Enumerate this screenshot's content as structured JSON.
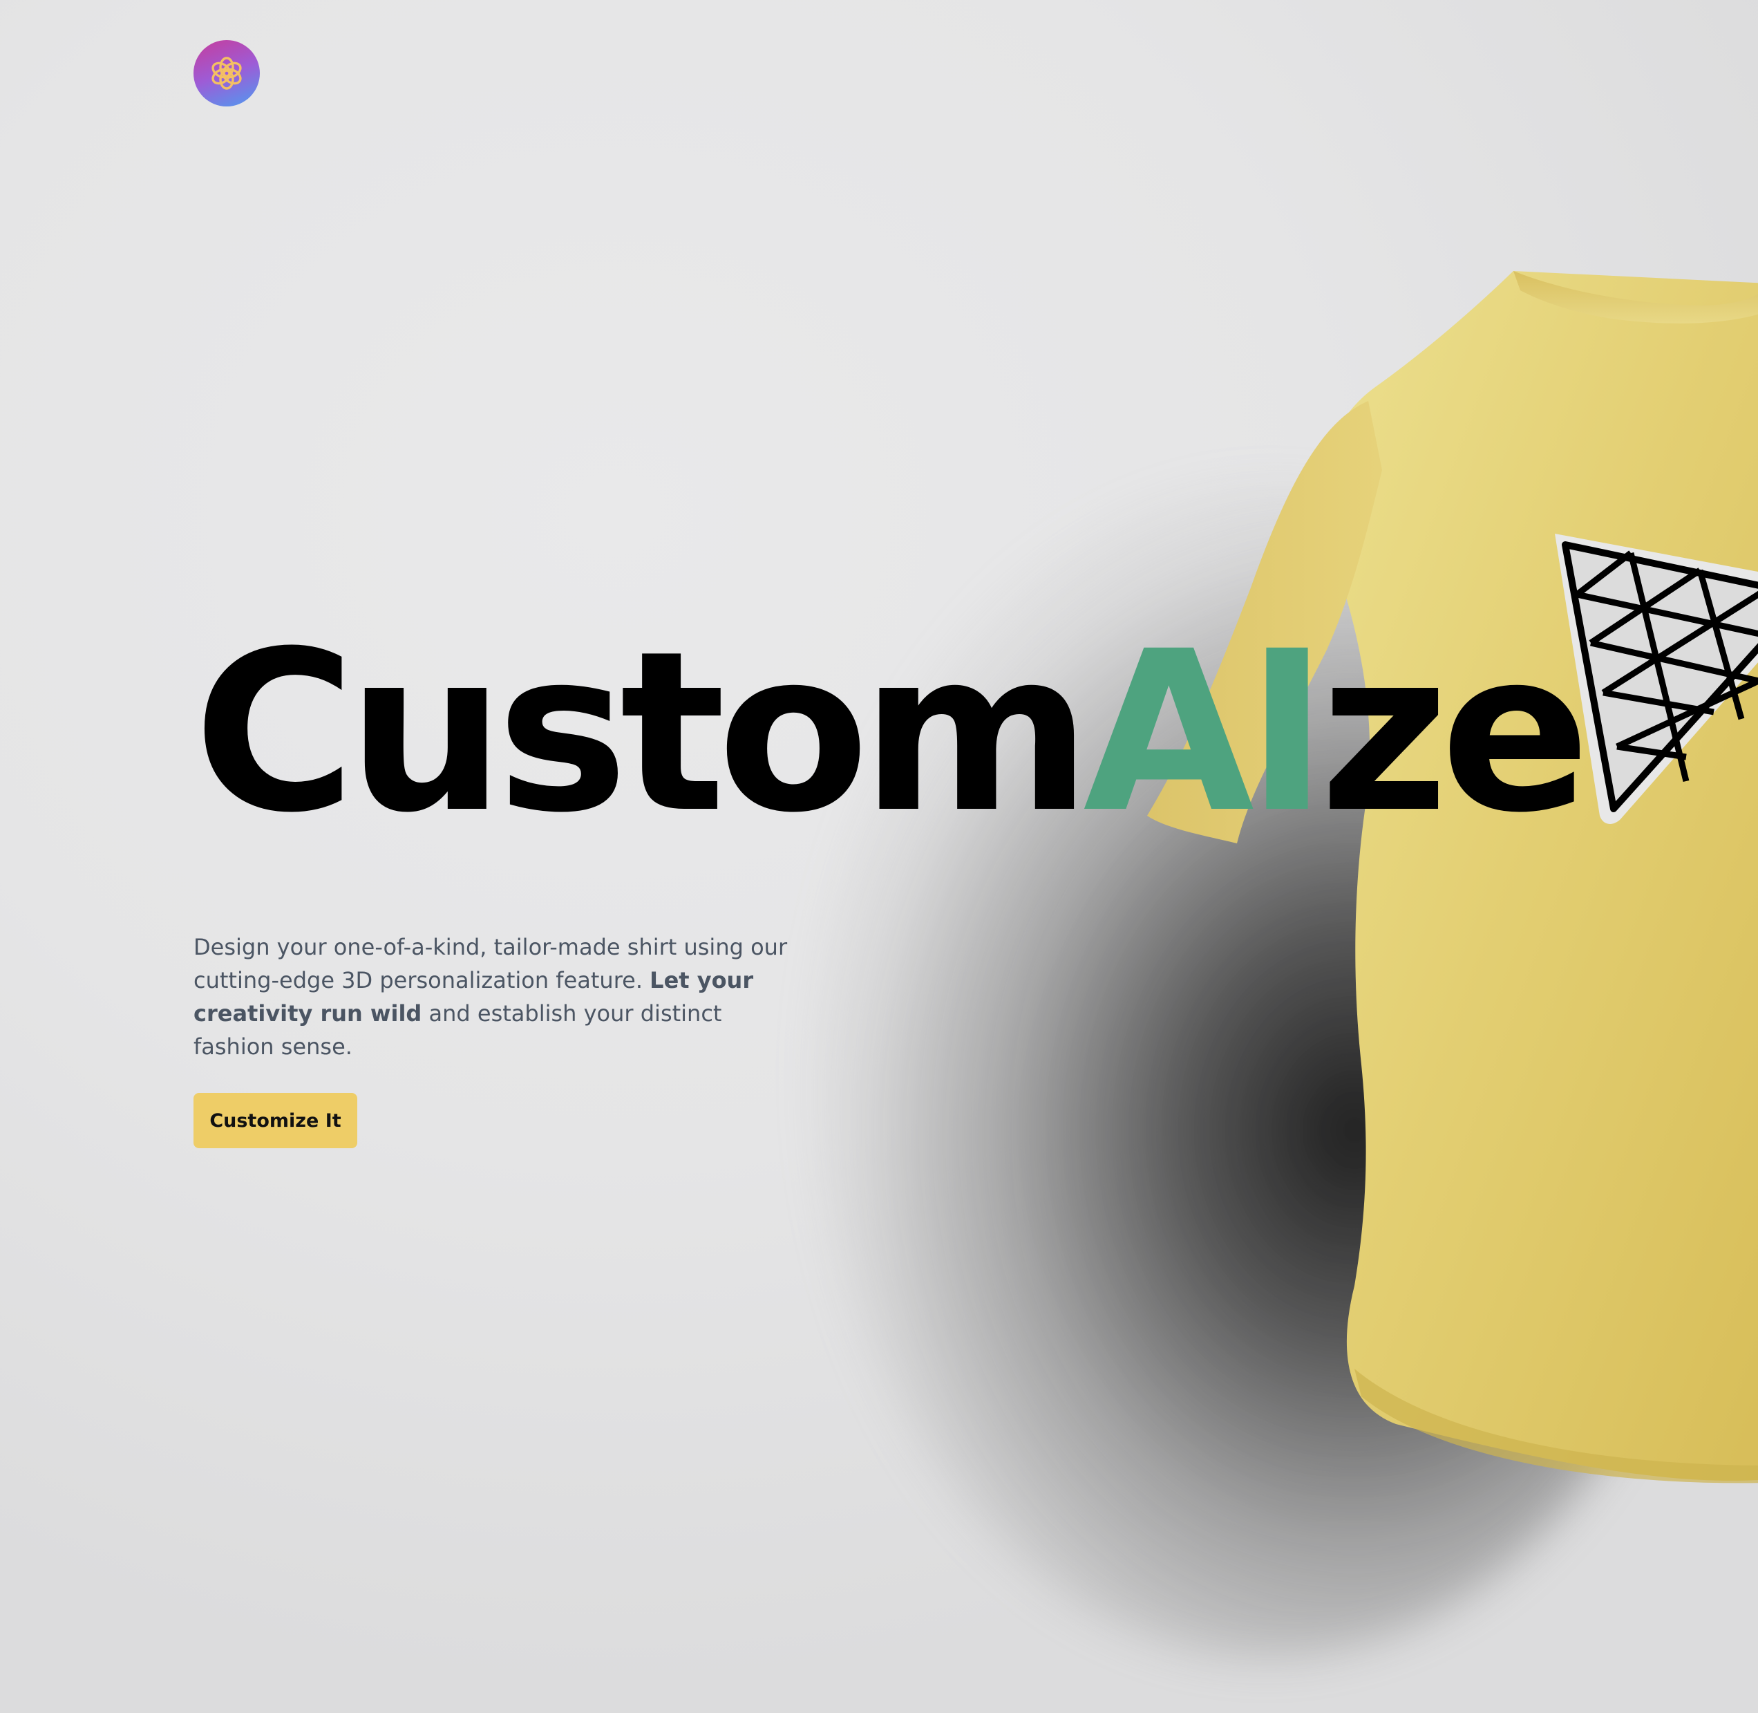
{
  "header": {
    "logo_icon": "openai-logo-icon"
  },
  "hero": {
    "title_part1": "Custom",
    "title_accent": "AI",
    "title_part2": "ze",
    "description_part1": "Design your one-of-a-kind, tailor-made shirt using our cutting-edge 3D personalization feature. ",
    "description_bold": "Let your creativity run wild",
    "description_part2": " and establish your distinct fashion sense.",
    "cta_label": "Customize It"
  },
  "colors": {
    "background": "#e6e6e7",
    "accent": "#4ea37f",
    "button": "#eecd67",
    "shirt": "#e6d27a"
  },
  "model": {
    "object": "t-shirt",
    "decal_icon": "triangle-grid-icon"
  }
}
